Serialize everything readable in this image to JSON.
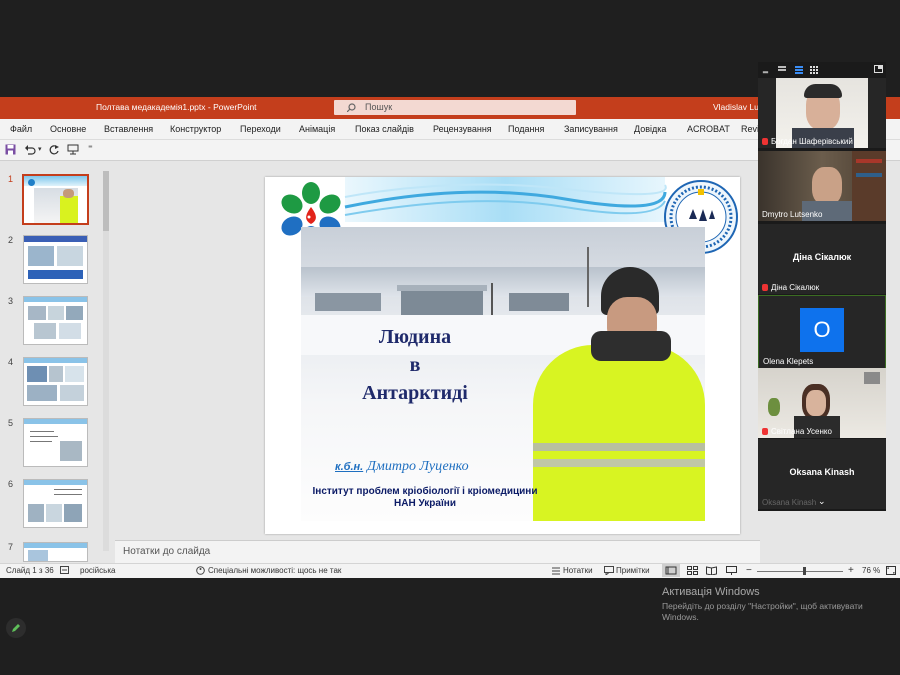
{
  "ppt": {
    "file_title": "Полтава медакадемія1.pptx  -  PowerPoint",
    "search_placeholder": "Пошук",
    "user": "Vladislav Lut",
    "tabs": [
      "Файл",
      "Основне",
      "Вставлення",
      "Конструктор",
      "Переходи",
      "Анімація",
      "Показ слайдів",
      "Рецензування",
      "Подання",
      "Записування",
      "Довідка",
      "ACROBAT",
      "Revi"
    ],
    "slide_numbers": [
      "1",
      "2",
      "3",
      "4",
      "5",
      "6",
      "7"
    ],
    "notes_placeholder": "Нотатки до слайда",
    "status": {
      "slide_info": "Слайд 1 з 36",
      "language": "російська",
      "accessibility": "Спеціальні можливості: щось не так",
      "notes_btn": "Нотатки",
      "comments_btn": "Примітки",
      "zoom": "76 %",
      "zoom_minus": "−",
      "zoom_plus": "+"
    }
  },
  "slide": {
    "title_line1": "Людина",
    "title_line2": "в",
    "title_line3": "Антарктиді",
    "degree": "к.б.н.",
    "author": "Дмитро Луценко",
    "institute_line1": "Інститут проблем кріобіології і кріомедицини",
    "institute_line2": "НАН України"
  },
  "zoom_participants": [
    {
      "name": "Богдан Шаферівський",
      "video": true,
      "muted": true
    },
    {
      "name": "Dmytro Lutsenko",
      "video": true,
      "muted": false
    },
    {
      "name": "Діна Сікалюк",
      "video": false,
      "muted": true,
      "center_label": "Діна Сікалюк"
    },
    {
      "name": "Olena Klepets",
      "video": false,
      "muted": false,
      "avatar_letter": "O"
    },
    {
      "name": "Світлана Усенко",
      "video": true,
      "muted": true
    },
    {
      "name": "Oksana Kinash",
      "video": false,
      "muted": false,
      "center_label": "Oksana Kinash"
    }
  ],
  "windows_activation": {
    "title": "Активація Windows",
    "line1": "Перейдіть до розділу \"Настройки\", щоб активувати",
    "line2": "Windows."
  },
  "colors": {
    "ppt_red": "#c43e1c",
    "zoom_blue": "#0e72ed",
    "slide_title": "#1f2a6b",
    "author_blue": "#1e6fc0"
  }
}
